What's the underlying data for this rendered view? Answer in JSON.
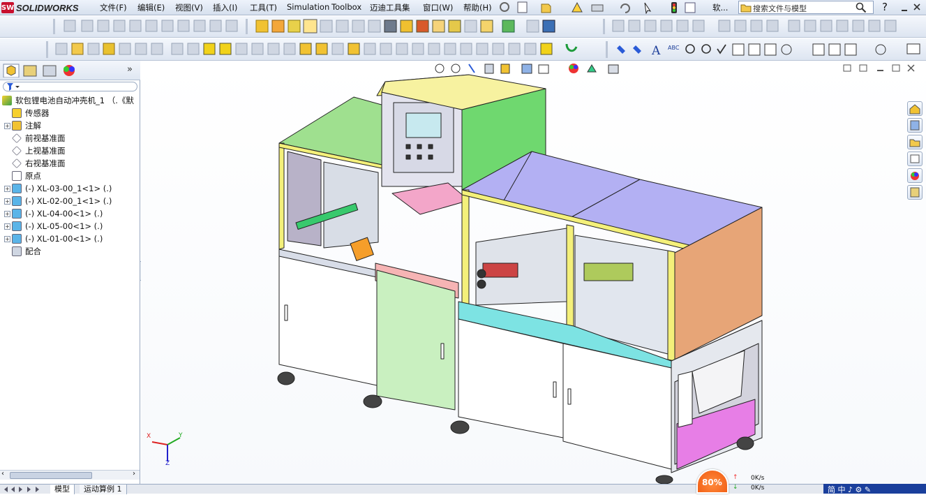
{
  "app": {
    "logo_badge": "SW",
    "logo_text": "SOLIDWORKS"
  },
  "menu": [
    "文件(F)",
    "编辑(E)",
    "视图(V)",
    "插入(I)",
    "工具(T)",
    "Simulation",
    "Toolbox",
    "迈迪工具集",
    "窗口(W)",
    "帮助(H)"
  ],
  "titlebar": {
    "doc_title": "软...",
    "search_placeholder": "搜索文件与模型",
    "help": "?"
  },
  "feature_tree": {
    "root": "软包锂电池自动冲壳机_1 （.《默",
    "items": [
      {
        "label": "传感器",
        "expandable": false,
        "icon": "sensor-icon"
      },
      {
        "label": "注解",
        "expandable": true,
        "icon": "annotation-icon"
      },
      {
        "label": "前视基准面",
        "expandable": false,
        "icon": "plane-icon"
      },
      {
        "label": "上视基准面",
        "expandable": false,
        "icon": "plane-icon"
      },
      {
        "label": "右视基准面",
        "expandable": false,
        "icon": "plane-icon"
      },
      {
        "label": "原点",
        "expandable": false,
        "icon": "origin-icon"
      },
      {
        "label": "(-) XL-03-00_1<1> (.)",
        "expandable": true,
        "icon": "subassembly-icon"
      },
      {
        "label": "(-) XL-02-00_1<1> (.)",
        "expandable": true,
        "icon": "subassembly-icon"
      },
      {
        "label": "(-) XL-04-00<1> (.)",
        "expandable": true,
        "icon": "subassembly-icon"
      },
      {
        "label": "(-) XL-05-00<1> (.)",
        "expandable": true,
        "icon": "subassembly-icon"
      },
      {
        "label": "(-) XL-01-00<1> (.)",
        "expandable": true,
        "icon": "subassembly-icon"
      },
      {
        "label": "配合",
        "expandable": false,
        "icon": "mates-icon"
      }
    ]
  },
  "bottom_tabs": [
    "模型",
    "运动算例 1"
  ],
  "network": {
    "cpu_percent": "80%",
    "up": "0K/s",
    "down": "0K/s"
  },
  "tray": {
    "ime": "简 中 ♪ ⚙ ✎"
  },
  "triad": {
    "x": "X",
    "y": "Y",
    "z": "Z"
  },
  "colors": {
    "accent": "#2a5bd7",
    "frame_yellow": "#f4f07a",
    "green_panel": "#6fd86f",
    "lavender": "#b3b0f3",
    "salmon": "#e7a577",
    "pink": "#f3a6c9",
    "magenta": "#e77ee6",
    "cyan": "#7de3e3"
  }
}
